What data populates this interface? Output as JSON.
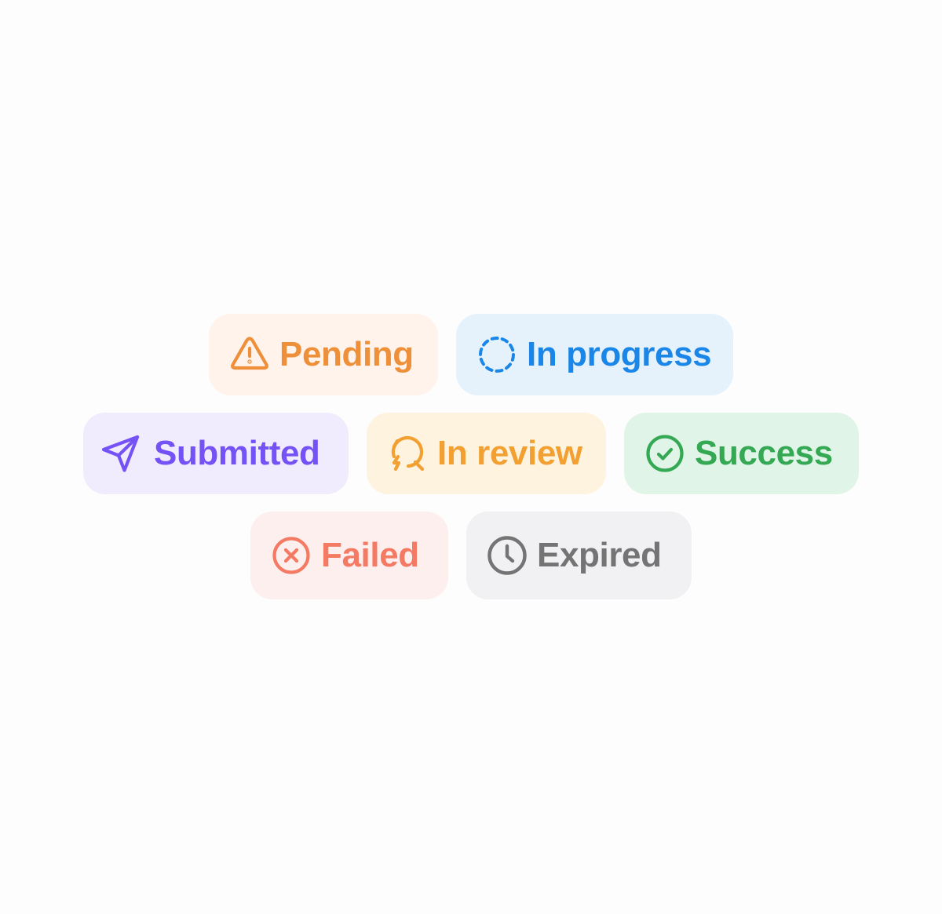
{
  "badges": {
    "pending": {
      "label": "Pending",
      "icon": "warning-triangle-icon",
      "text_color": "#EE8F3A",
      "bg_color": "#FFF3EC"
    },
    "in_progress": {
      "label": "In progress",
      "icon": "dashed-circle-icon",
      "text_color": "#1A86E8",
      "bg_color": "#E5F2FC"
    },
    "submitted": {
      "label": "Submitted",
      "icon": "send-arrow-icon",
      "text_color": "#7452F5",
      "bg_color": "#F0EBFD"
    },
    "in_review": {
      "label": "In review",
      "icon": "review-search-icon",
      "text_color": "#F2A031",
      "bg_color": "#FEF3DF"
    },
    "success": {
      "label": "Success",
      "icon": "check-circle-icon",
      "text_color": "#34A853",
      "bg_color": "#E1F4E8"
    },
    "failed": {
      "label": "Failed",
      "icon": "x-circle-icon",
      "text_color": "#F47A63",
      "bg_color": "#FEEFEF"
    },
    "expired": {
      "label": "Expired",
      "icon": "clock-icon",
      "text_color": "#747474",
      "bg_color": "#F1F0F2"
    }
  }
}
